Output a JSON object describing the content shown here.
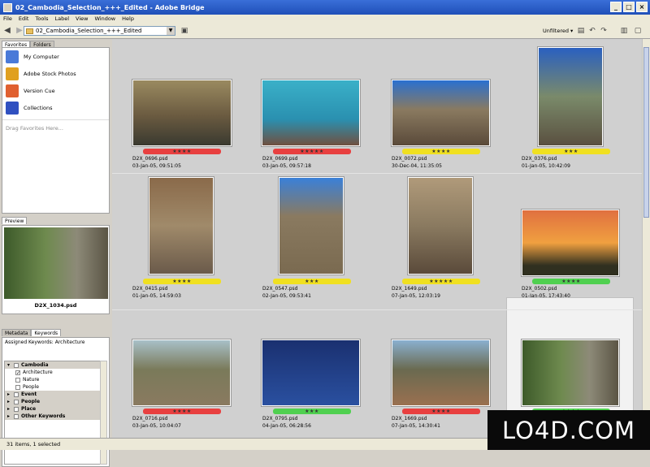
{
  "window": {
    "title": "02_Cambodia_Selection_+++_Edited - Adobe Bridge"
  },
  "menu": [
    "File",
    "Edit",
    "Tools",
    "Label",
    "View",
    "Window",
    "Help"
  ],
  "toolbar": {
    "path": "02_Cambodia_Selection_+++_Edited",
    "filter": "Unfiltered ▾"
  },
  "favorites_tabs": [
    "Favorites",
    "Folders"
  ],
  "favorites": [
    {
      "label": "My Computer",
      "color": "#4a7ad8"
    },
    {
      "label": "Adobe Stock Photos",
      "color": "#e0a020"
    },
    {
      "label": "Version Cue",
      "color": "#e06030"
    },
    {
      "label": "Collections",
      "color": "#3050c0"
    }
  ],
  "favorites_hint": "Drag Favorites Here...",
  "preview": {
    "tab": "Preview",
    "caption": "D2X_1034.psd"
  },
  "meta_tabs": [
    "Metadata",
    "Keywords"
  ],
  "keywords": {
    "assigned": "Assigned Keywords: Architecture",
    "rows": [
      {
        "label": "Cambodia",
        "group": true,
        "checked": false
      },
      {
        "label": "Architecture",
        "group": false,
        "checked": true
      },
      {
        "label": "Nature",
        "group": false,
        "checked": false
      },
      {
        "label": "People",
        "group": false,
        "checked": false
      },
      {
        "label": "Event",
        "group": true,
        "checked": false
      },
      {
        "label": "People",
        "group": true,
        "checked": false
      },
      {
        "label": "Place",
        "group": true,
        "checked": false
      },
      {
        "label": "Other Keywords",
        "group": true,
        "checked": false
      }
    ]
  },
  "status": "31 items, 1 selected",
  "watermark": "LO4D.COM",
  "thumbnails": [
    {
      "file": "D2X_0696.psd",
      "date": "03-Jan-05, 09:51:05",
      "stars": "★★★★",
      "label": "#e84040",
      "bg": "linear-gradient(#9a8a60,#6a5a40 55%,#3a3a30)"
    },
    {
      "file": "D2X_0699.psd",
      "date": "03-Jan-05, 09:57:18",
      "stars": "★★★★★",
      "label": "#e84040",
      "bg": "linear-gradient(#3ab0c8,#2a90b0 60%,#705040)"
    },
    {
      "file": "D2X_0072.psd",
      "date": "30-Dec-04, 11:35:05",
      "stars": "★★★★",
      "label": "#f0e020",
      "bg": "linear-gradient(#2a70d0,#8a7a60 45%,#5a4a3a)"
    },
    {
      "file": "D2X_0376.psd",
      "date": "01-Jan-05, 10:42:09",
      "stars": "★★★",
      "label": "#f0e020",
      "bg": "linear-gradient(#2a60c0,#7a8a6a 50%,#5a5040)"
    },
    {
      "file": "D2X_0415.psd",
      "date": "01-Jan-05, 14:59:03",
      "stars": "★★★★",
      "label": "#f0e020",
      "bg": "linear-gradient(#8a6a4a,#a08a6a 50%,#6a5a4a)"
    },
    {
      "file": "D2X_0547.psd",
      "date": "02-Jan-05, 09:53:41",
      "stars": "★★★",
      "label": "#f0e020",
      "bg": "linear-gradient(#3a80d8,#8a7a60 40%,#7a6a50)"
    },
    {
      "file": "D2X_1649.psd",
      "date": "07-Jan-05, 12:03:19",
      "stars": "★★★★★",
      "label": "#f0e020",
      "bg": "linear-gradient(#b09a7a,#8a7a60 50%,#5a4a3a)"
    },
    {
      "file": "D2X_0502.psd",
      "date": "01-Jan-05, 17:43:40",
      "stars": "★★★★",
      "label": "#50d050",
      "bg": "linear-gradient(#e07040,#f0a040 50%,#303020 85%)"
    },
    {
      "file": "D2X_0716.psd",
      "date": "03-Jan-05, 10:04:07",
      "stars": "★★★★",
      "label": "#e84040",
      "bg": "linear-gradient(#a8c0c8,#7a7a5a 45%,#8a7a60)"
    },
    {
      "file": "D2X_0795.psd",
      "date": "04-Jan-05, 06:28:56",
      "stars": "★★★",
      "label": "#50d050",
      "bg": "linear-gradient(#1a3070,#2a50a0)"
    },
    {
      "file": "D2X_1669.psd",
      "date": "07-Jan-05, 14:30:41",
      "stars": "★★★★",
      "label": "#e84040",
      "bg": "linear-gradient(#8ab0d0,#6a6a50 45%,#9a7050)"
    },
    {
      "file": "D2X_1034.psd",
      "date": "",
      "stars": "★★★★",
      "label": "#50d050",
      "bg": "linear-gradient(90deg,#3d5a2a,#6e8a4e 40%,#8d8a78 70%,#5b5545)"
    }
  ]
}
